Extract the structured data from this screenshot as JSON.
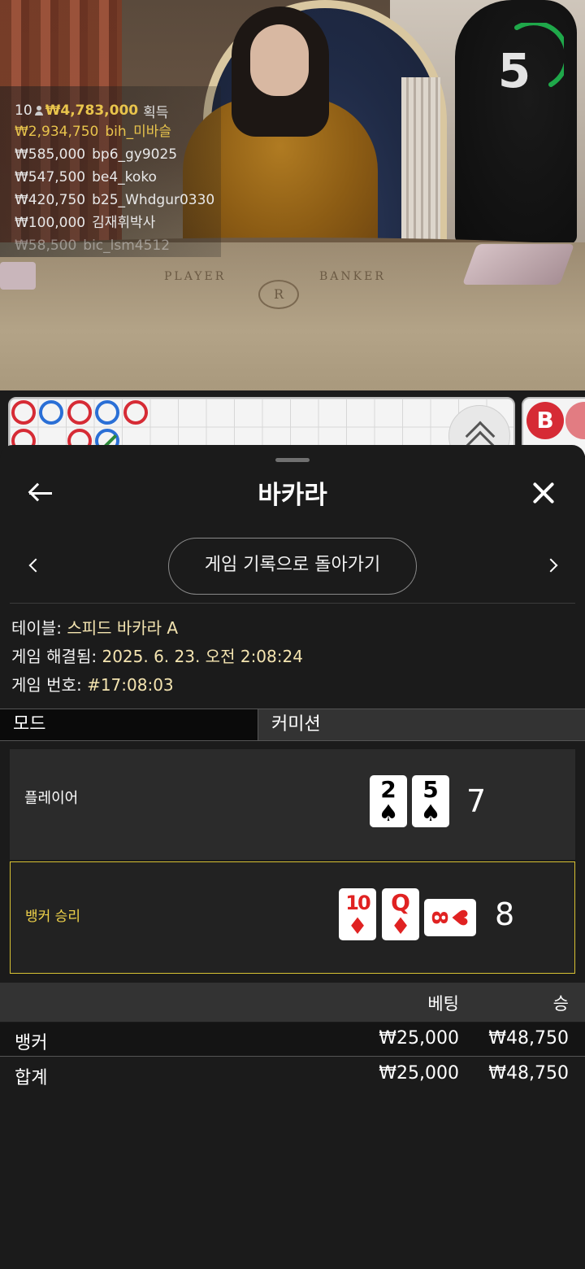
{
  "video": {
    "felt_player": "PLAYER",
    "felt_banker": "BANKER",
    "felt_logo": "R",
    "countdown": "5",
    "winners": {
      "count": "10",
      "total": "₩4,783,000",
      "gain_label": "획득",
      "rows": [
        {
          "amount": "₩2,934,750",
          "name": "bih_미바슬"
        },
        {
          "amount": "₩585,000",
          "name": "bp6_gy9025"
        },
        {
          "amount": "₩547,500",
          "name": "be4_koko"
        },
        {
          "amount": "₩420,750",
          "name": "b25_Whdgur0330"
        },
        {
          "amount": "₩100,000",
          "name": "김재휘박사"
        },
        {
          "amount": "₩58,500",
          "name": "bic_lsm4512"
        }
      ]
    },
    "roadmap_side_letter": "B"
  },
  "sheet": {
    "title": "바카라",
    "history_button": "게임 기록으로 돌아가기",
    "info": {
      "table_label": "테이블:",
      "table_value": "스피드 바카라 A",
      "resolved_label": "게임 해결됨:",
      "resolved_value": "2025. 6. 23. 오전 2:08:24",
      "number_label": "게임 번호:",
      "number_value": "#17:08:03"
    },
    "tabs": {
      "mode": "모드",
      "commission": "커미션"
    },
    "player": {
      "label": "플레이어",
      "cards": [
        {
          "rank": "2",
          "suit": "♠"
        },
        {
          "rank": "5",
          "suit": "♠"
        }
      ],
      "score": "7"
    },
    "banker": {
      "label": "뱅커 승리",
      "cards": [
        {
          "rank": "10",
          "suit": "♦"
        },
        {
          "rank": "Q",
          "suit": "♦"
        },
        {
          "rank": "8",
          "suit": "♥"
        }
      ],
      "score": "8"
    },
    "bets": {
      "header_bet": "베팅",
      "header_win": "승",
      "rows": [
        {
          "name": "뱅커",
          "bet": "₩25,000",
          "win": "₩48,750"
        }
      ],
      "total": {
        "name": "합계",
        "bet": "₩25,000",
        "win": "₩48,750"
      }
    }
  },
  "colors": {
    "banker_red": "#d62b35",
    "player_blue": "#2a6fd6",
    "winner_gold": "#f0d34a",
    "timer_green": "#1fa84a"
  }
}
